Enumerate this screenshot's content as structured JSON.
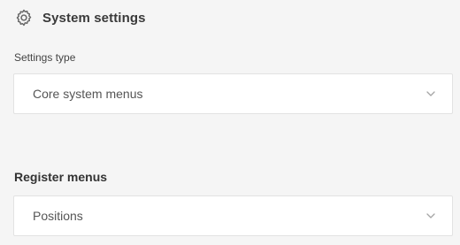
{
  "header": {
    "icon": "gear-icon",
    "title": "System settings"
  },
  "settings_type": {
    "label": "Settings type",
    "selected": "Core system menus"
  },
  "register_menus": {
    "title": "Register menus",
    "selected": "Positions"
  },
  "colors": {
    "background": "#f5f5f5",
    "field_background": "#ffffff",
    "field_border": "#e2e2e2",
    "chevron": "#a5a5a5"
  }
}
